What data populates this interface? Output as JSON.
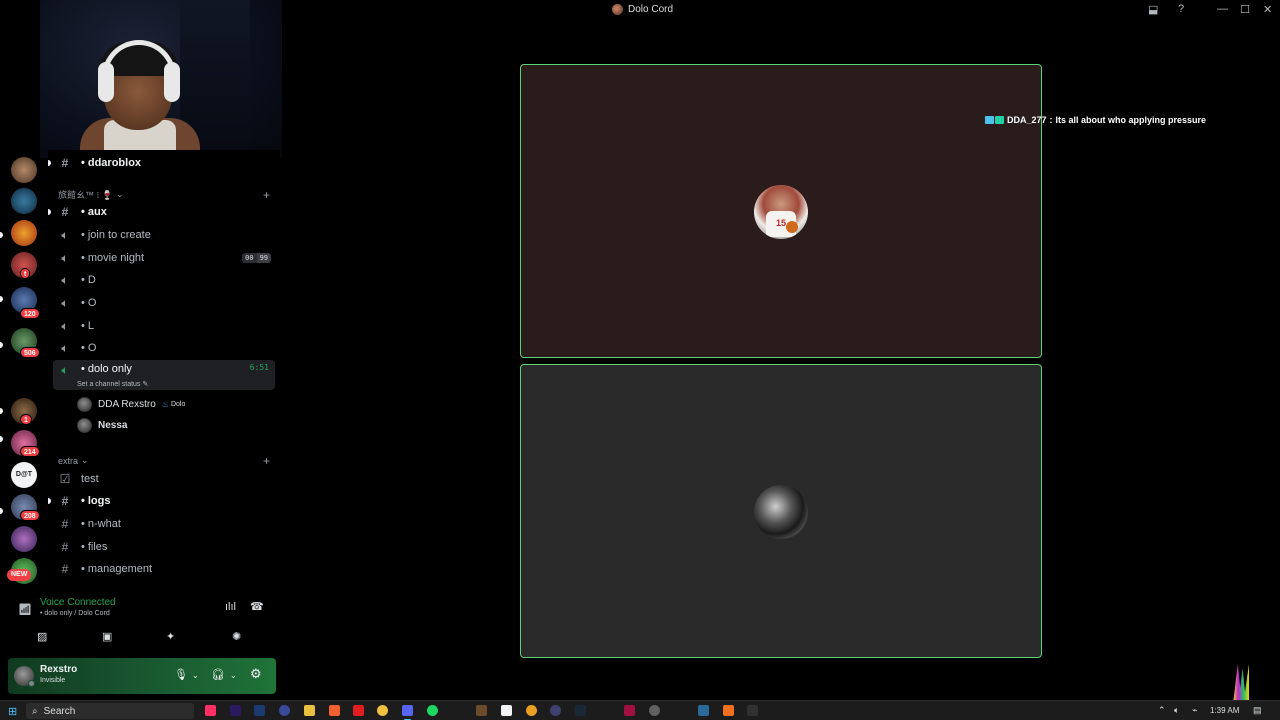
{
  "window": {
    "title": "Dolo Cord",
    "controls": {
      "inbox_icon": "⬓",
      "help_icon": "?",
      "minimize": "—",
      "maximize": "☐",
      "close": "✕"
    }
  },
  "servers": {
    "badges": [
      "1",
      "214",
      "208",
      "120",
      "506"
    ],
    "new_label": "NEW",
    "dd_initials": "t",
    "dd_logo": "D@T"
  },
  "channels": {
    "top_channel": "ddaroblox",
    "category_1": "旅館ㄠ™ ⁝ 🍷",
    "category_2": "extra",
    "items": [
      {
        "name": "aux"
      },
      {
        "name": "join to create"
      },
      {
        "name": "movie night",
        "count_left": "00",
        "count_right": "99"
      },
      {
        "name": "D"
      },
      {
        "name": "O"
      },
      {
        "name": "L"
      },
      {
        "name": "O"
      },
      {
        "name": "dolo only",
        "timer": "6:51"
      }
    ],
    "bullet": "•",
    "channel_status": "Set a channel status",
    "members": [
      {
        "name": "DDA Rexstro",
        "tag": "Dolo"
      },
      {
        "name": "Nessa"
      }
    ],
    "extra_items": [
      "test",
      "logs",
      "n-what",
      "files",
      "management"
    ]
  },
  "voice": {
    "title": "Voice Connected",
    "subtitle": "dolo only / Dolo Cord"
  },
  "user": {
    "name": "Rexstro",
    "status": "Invisible"
  },
  "tiles": {
    "jersey_number": "15"
  },
  "stream_chat": {
    "user": "DDA_277",
    "separator": ":",
    "message": "Its all about who applying pressure"
  },
  "taskbar": {
    "search_placeholder": "Search",
    "clock": "1:39 AM"
  },
  "colors": {
    "accent_green": "#23a55a",
    "tile_border": "#5dd37a",
    "badge_red": "#f23f43"
  }
}
